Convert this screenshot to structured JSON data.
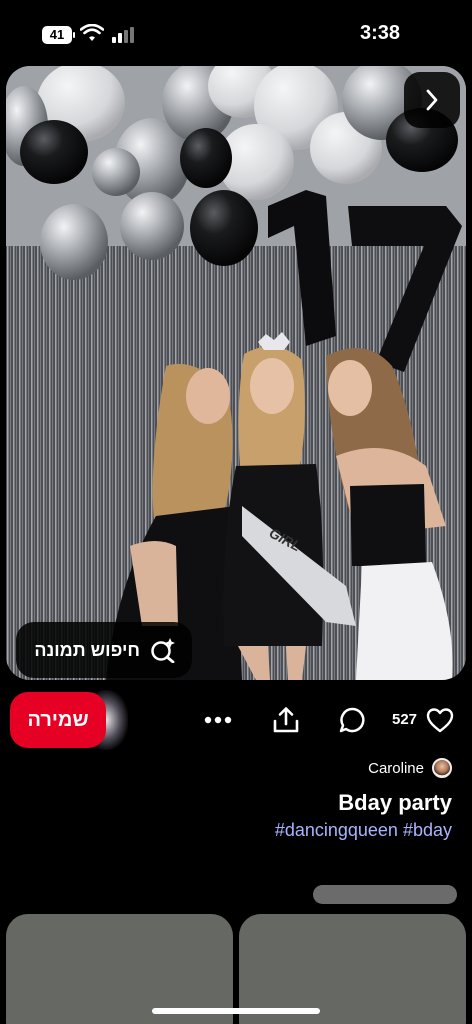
{
  "status_bar": {
    "battery": "41",
    "time": "3:38"
  },
  "pin": {
    "image_alt": "Three girls posing in front of silver fringe curtain with balloons and number 17 balloons",
    "visual_search_label": "חיפוש תמונה",
    "balloon_number": "17",
    "sash_text": "GIRL"
  },
  "actions": {
    "save_label": "שמירה",
    "like_count": "527",
    "icons": [
      "more-icon",
      "share-icon",
      "comment-icon",
      "heart-icon"
    ]
  },
  "meta": {
    "creator_name": "Caroline",
    "title": "Bday party",
    "hashtags": [
      "#dancingqueen",
      "#bday"
    ]
  },
  "colors": {
    "save": "#e60023",
    "hashtag": "#a9b4ff",
    "background": "#000000"
  }
}
